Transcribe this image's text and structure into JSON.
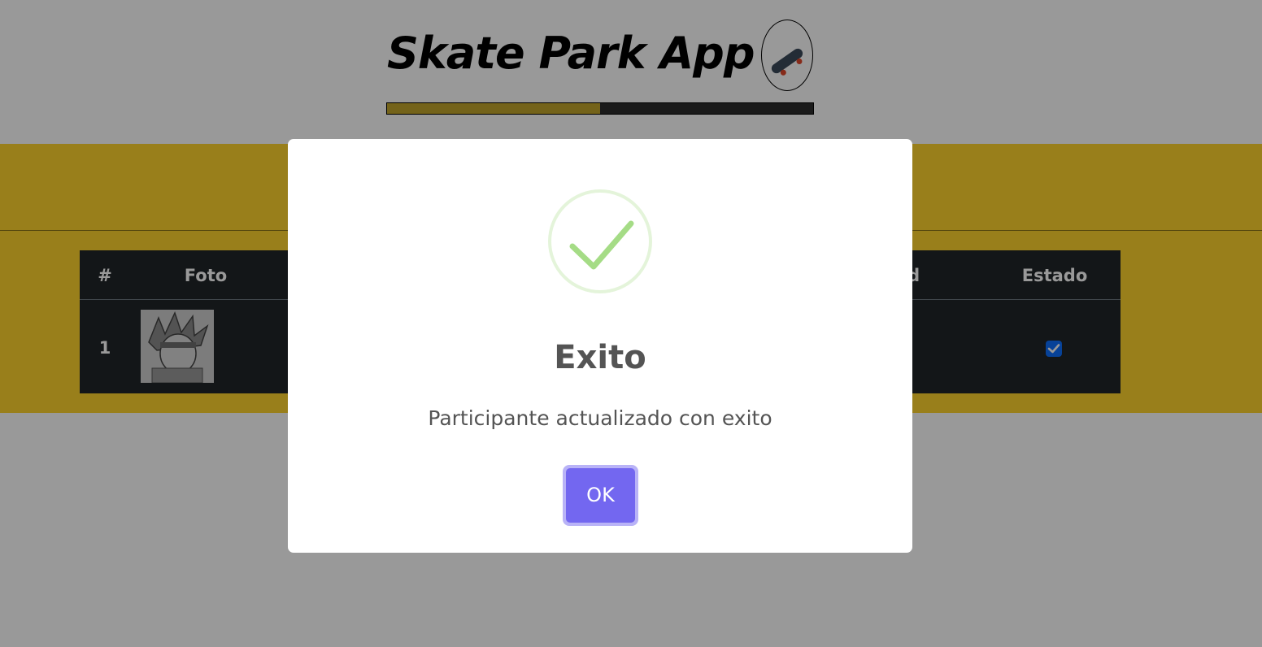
{
  "app": {
    "title": "Skate Park App",
    "logo_icon": "skateboard-icon",
    "progress": 0.5
  },
  "table": {
    "headers": {
      "number": "#",
      "photo": "Foto",
      "age": "iad",
      "status": "Estado"
    },
    "rows": [
      {
        "number": "1",
        "status_checked": true
      }
    ]
  },
  "dialog": {
    "icon": "success-check-icon",
    "title": "Exito",
    "message": "Participante actualizado con exito",
    "confirm_label": "OK"
  },
  "colors": {
    "band": "#ffd42e",
    "table_bg": "#212529",
    "confirm_button": "#7367f0",
    "success": "#a5dc86",
    "checkbox": "#0d6efd"
  }
}
